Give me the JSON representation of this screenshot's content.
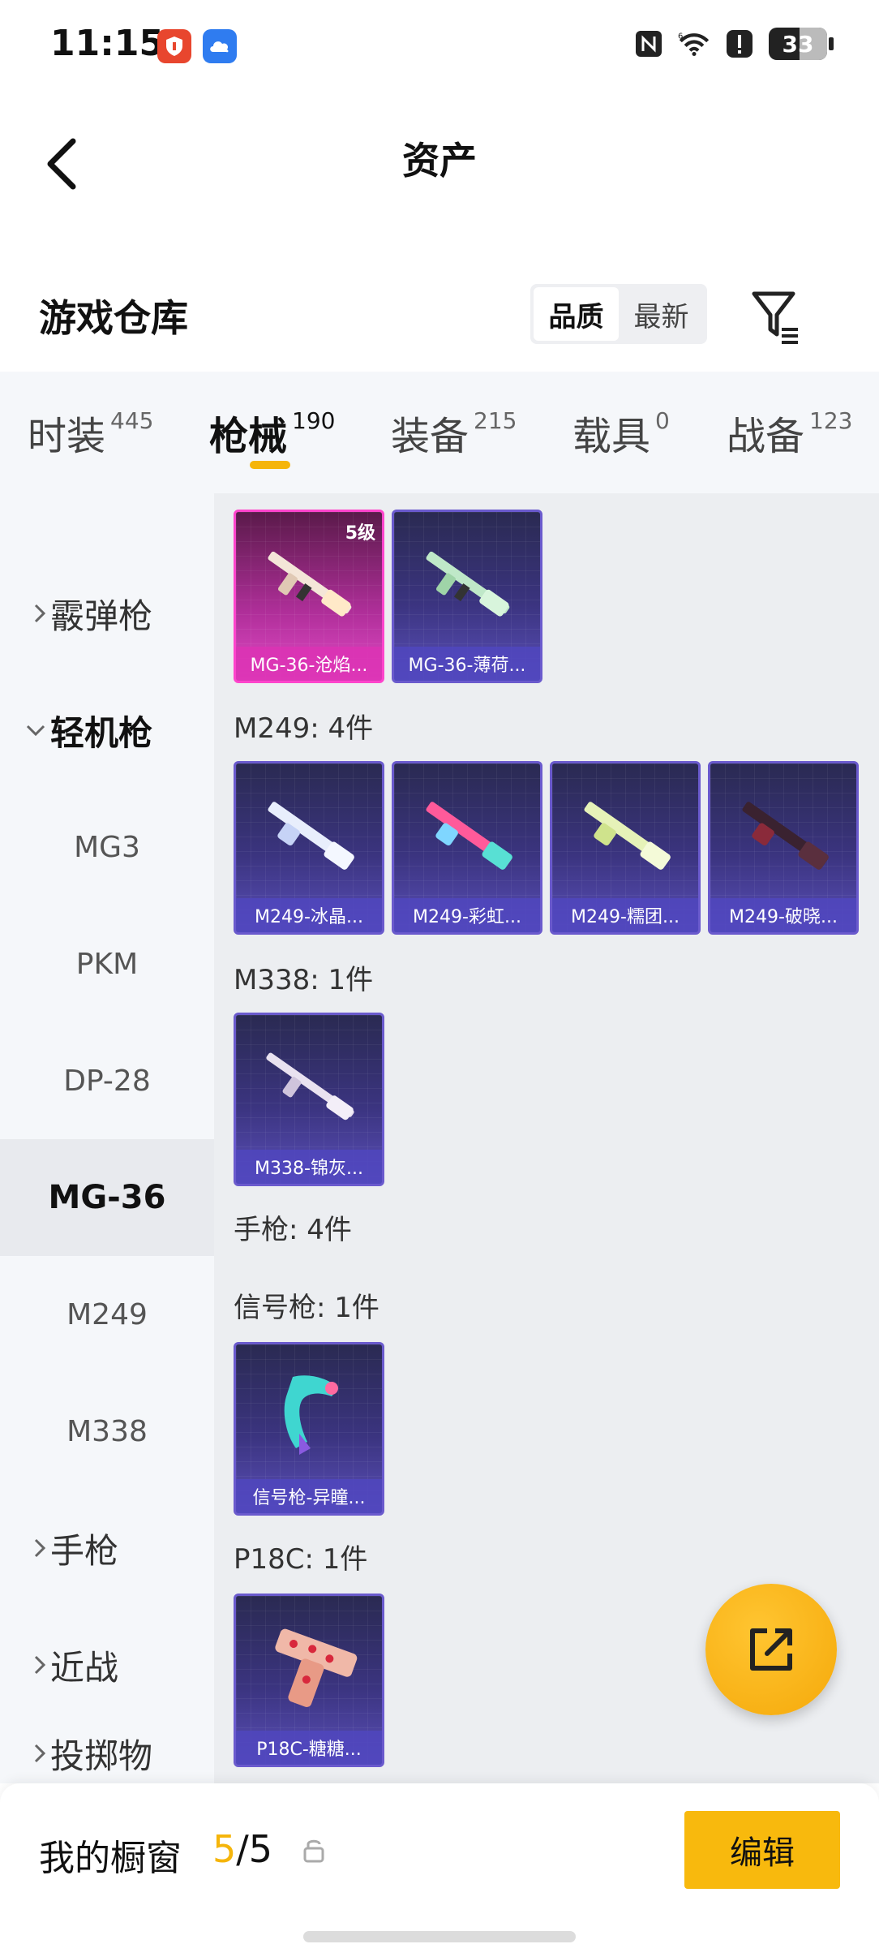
{
  "status_bar": {
    "time": "11:15",
    "battery": "33",
    "icons": [
      "shield-app-icon",
      "cloud-app-icon",
      "nfc-icon",
      "wifi-6-icon",
      "alert-icon",
      "battery-icon"
    ]
  },
  "header": {
    "title": "资产"
  },
  "warehouse": {
    "title": "游戏仓库",
    "sort_options": [
      "品质",
      "最新"
    ],
    "sort_selected": "品质"
  },
  "tabs": [
    {
      "label": "时装",
      "count": "445"
    },
    {
      "label": "枪械",
      "count": "190"
    },
    {
      "label": "装备",
      "count": "215"
    },
    {
      "label": "载具",
      "count": "0"
    },
    {
      "label": "战备",
      "count": "123"
    }
  ],
  "sidebar": {
    "categories": [
      {
        "label": "霰弹枪"
      },
      {
        "label": "轻机枪"
      },
      {
        "label": "手枪"
      },
      {
        "label": "近战"
      },
      {
        "label": "投掷物"
      }
    ],
    "subitems": [
      "MG3",
      "PKM",
      "DP-28",
      "MG-36",
      "M249",
      "M338"
    ]
  },
  "content": {
    "groups": {
      "m249": "M249: 4件",
      "m338": "M338: 1件",
      "pistol": "手枪: 4件",
      "flare": "信号枪: 1件",
      "p18c": "P18C: 1件"
    },
    "cards": {
      "mg36_1": {
        "name": "MG-36-沧焰...",
        "level": "5级"
      },
      "mg36_2": {
        "name": "MG-36-薄荷..."
      },
      "m249_1": {
        "name": "M249-冰晶..."
      },
      "m249_2": {
        "name": "M249-彩虹..."
      },
      "m249_3": {
        "name": "M249-糯团..."
      },
      "m249_4": {
        "name": "M249-破晓..."
      },
      "m338_1": {
        "name": "M338-锦灰..."
      },
      "flare_1": {
        "name": "信号枪-异瞳..."
      },
      "p18c_1": {
        "name": "P18C-糖糖..."
      }
    }
  },
  "bottom_bar": {
    "label": "我的橱窗",
    "count_current": "5",
    "count_total": "/5",
    "edit_label": "编辑"
  },
  "colors": {
    "accent": "#f5b50b",
    "card_purple": "#3b3480",
    "card_pink": "#e24ac6"
  }
}
